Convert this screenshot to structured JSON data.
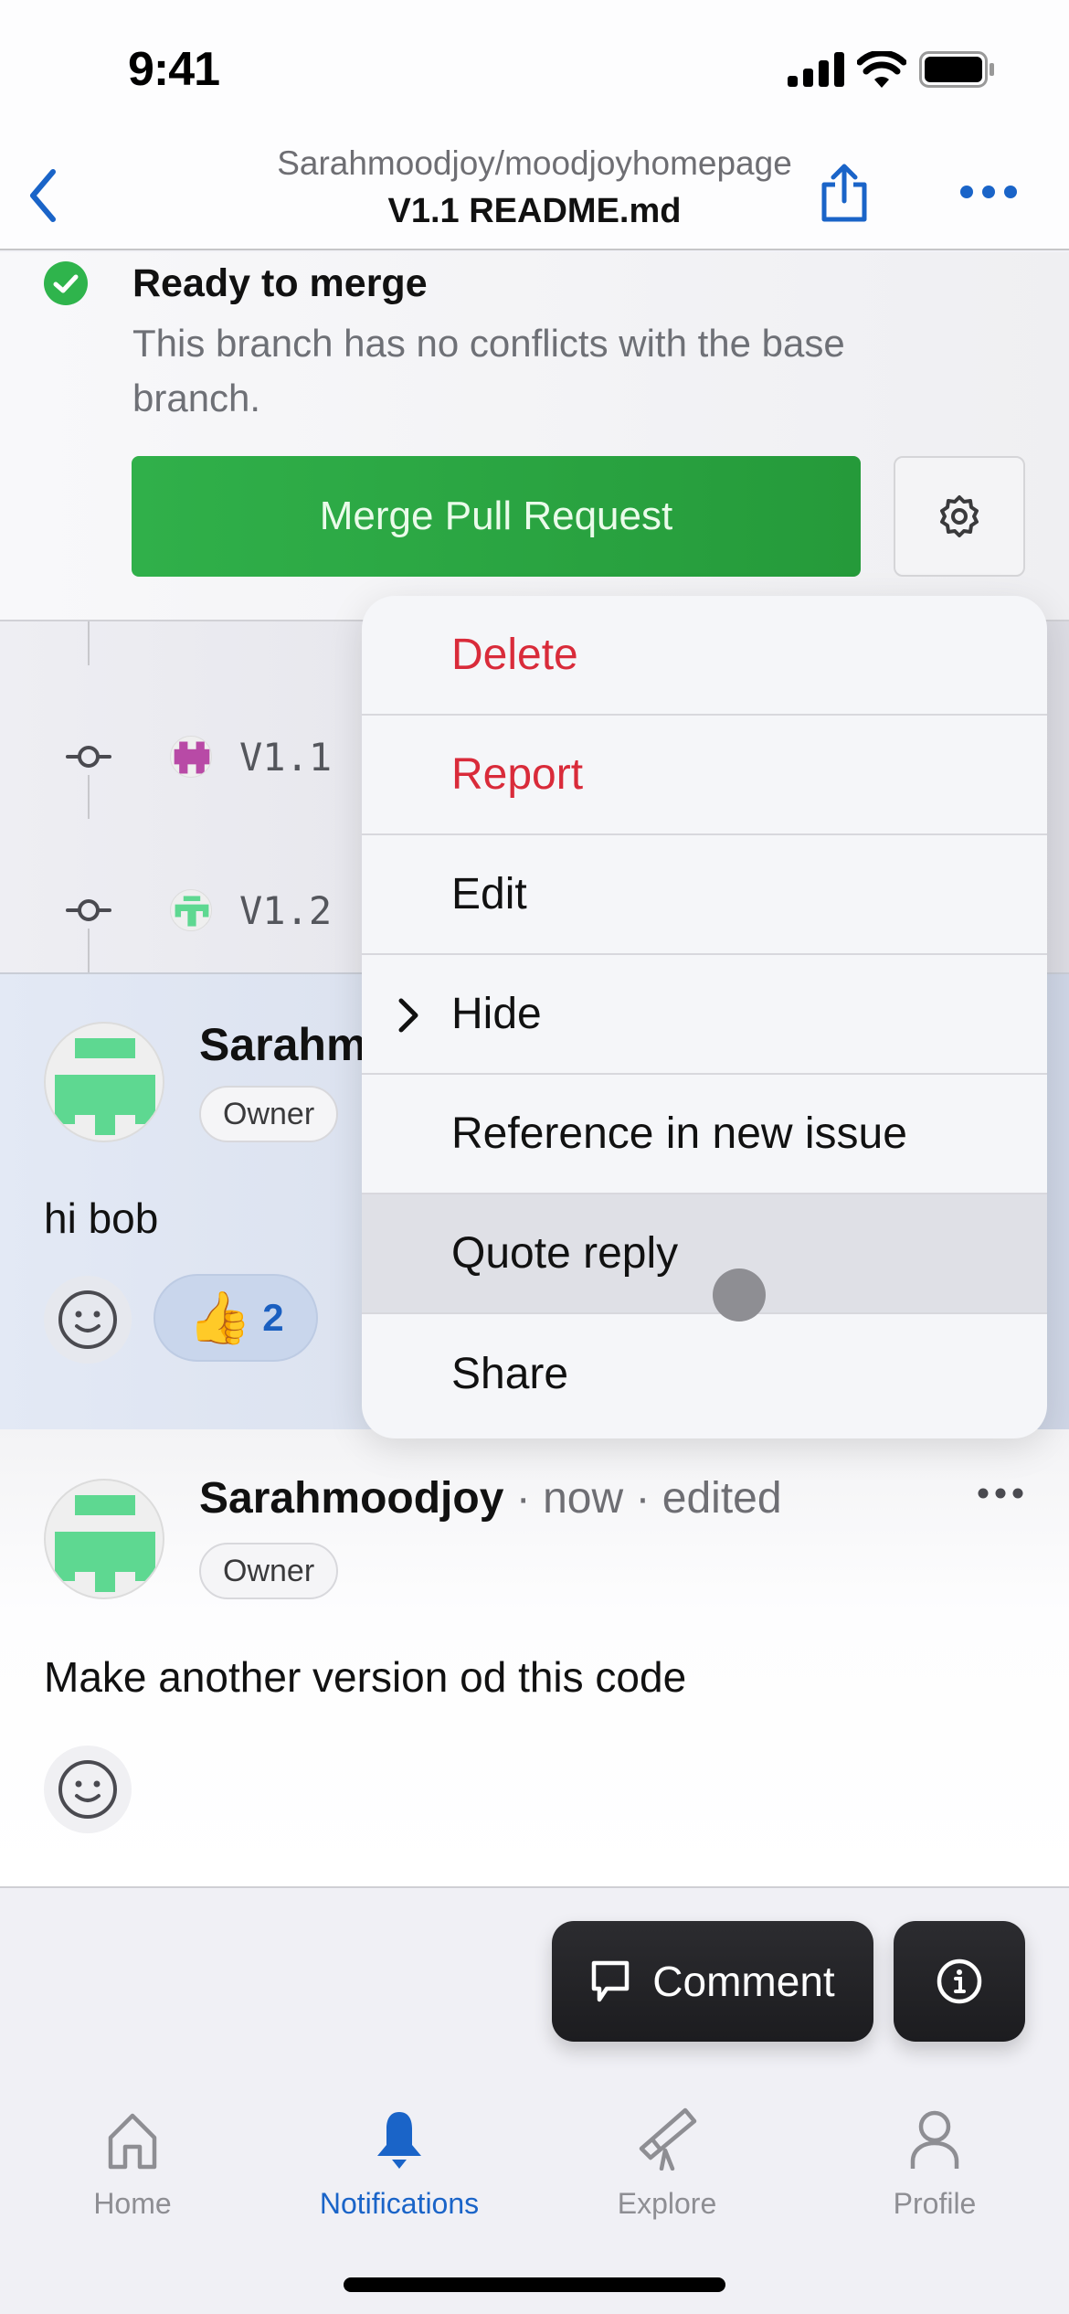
{
  "status_bar": {
    "time": "9:41"
  },
  "nav": {
    "repo": "Sarahmoodjoy/moodjoyhomepage",
    "file": "V1.1 README.md",
    "back_icon": "chevron-left-icon",
    "share_icon": "share-icon",
    "more_icon": "ellipsis-icon"
  },
  "merge": {
    "title": "Ready to merge",
    "description": "This branch has no conflicts with the base branch.",
    "button": "Merge Pull Request",
    "status_color": "#2da44e"
  },
  "commits": [
    {
      "label": "V1.1",
      "avatar_color": "#b84aa6"
    },
    {
      "label": "V1.2",
      "avatar_color": "#5ed891"
    }
  ],
  "comment1": {
    "author": "Sarahmoodjoy",
    "author_visible": "Sarahm",
    "badge": "Owner",
    "body": "hi bob",
    "reactions": [
      {
        "emoji": "👍",
        "count": "2"
      }
    ]
  },
  "comment2": {
    "author": "Sarahmoodjoy",
    "time": " · now",
    "edited": " · edited",
    "badge": "Owner",
    "body": "Make another version od this code"
  },
  "context_menu": {
    "items": [
      {
        "label": "Delete",
        "destructive": true
      },
      {
        "label": "Report",
        "destructive": true
      },
      {
        "label": "Edit"
      },
      {
        "label": "Hide",
        "has_submenu": true
      },
      {
        "label": "Reference in new issue"
      },
      {
        "label": "Quote reply",
        "highlighted": true
      },
      {
        "label": "Share"
      }
    ]
  },
  "actions": {
    "comment": "Comment"
  },
  "tabs": [
    {
      "label": "Home",
      "icon": "home-icon"
    },
    {
      "label": "Notifications",
      "icon": "bell-icon",
      "active": true
    },
    {
      "label": "Explore",
      "icon": "telescope-icon"
    },
    {
      "label": "Profile",
      "icon": "person-icon"
    }
  ],
  "colors": {
    "accent": "#1a64c8",
    "destructive": "#d92b3a",
    "merge_green": "#2da44e"
  }
}
